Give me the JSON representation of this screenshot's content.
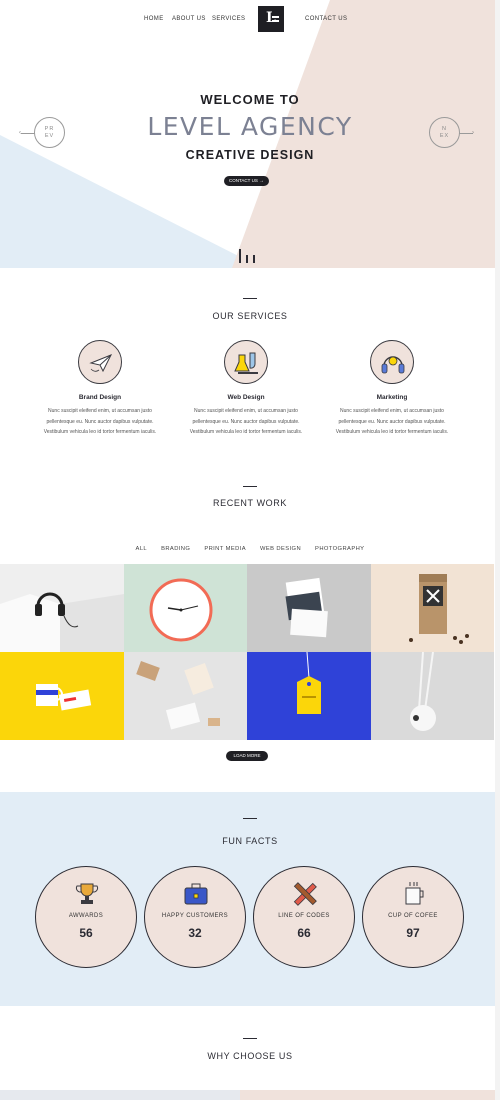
{
  "nav": {
    "items": [
      {
        "label": "HOME"
      },
      {
        "label": "ABOUT US"
      },
      {
        "label": "SERVICES"
      },
      {
        "label": "CONTACT US"
      }
    ],
    "logo_letter": "L"
  },
  "hero": {
    "welcome": "WELCOME TO",
    "title": "LEVEL AGENCY",
    "subtitle": "CREATIVE DESIGN",
    "cta": "CONTACT US",
    "prev": {
      "line1": "PR",
      "line2": "EV"
    },
    "next": {
      "line1": "N",
      "line2": "EX"
    }
  },
  "services": {
    "title": "OUR SERVICES",
    "items": [
      {
        "name": "Brand Design",
        "icon": "paper-plane-icon",
        "text": "Nunc suscipit eleifend enim, ut accumsan justo pellentesque eu. Nunc auctor dapibus vulputate. Vestibulum vehicula leo id tortor fermentum iaculis."
      },
      {
        "name": "Web Design",
        "icon": "flask-icon",
        "text": "Nunc suscipit eleifend enim, ut accumsan justo pellentesque eu. Nunc auctor dapibus vulputate. Vestibulum vehicula leo id tortor fermentum iaculis."
      },
      {
        "name": "Marketing",
        "icon": "headphones-icon",
        "text": "Nunc suscipit eleifend enim, ut accumsan justo pellentesque eu. Nunc auctor dapibus vulputate. Vestibulum vehicula leo id tortor fermentum iaculis."
      }
    ]
  },
  "work": {
    "title": "RECENT WORK",
    "filters": [
      "ALL",
      "BRADING",
      "PRINT MEDIA",
      "WEB DESIGN",
      "PHOTOGRAPHY"
    ],
    "tiles": [
      {
        "subject": "headphones",
        "bg": "#efefef"
      },
      {
        "subject": "wall-clock",
        "bg": "#cfe3d6"
      },
      {
        "subject": "business-cards",
        "bg": "#c9c9c9"
      },
      {
        "subject": "coffee-bag",
        "bg": "#f2e3d4"
      },
      {
        "subject": "mug-and-card",
        "bg": "#fbd60a"
      },
      {
        "subject": "stationery",
        "bg": "#e4e4e4"
      },
      {
        "subject": "hang-tag",
        "bg": "#2f42d8"
      },
      {
        "subject": "desk-lamp",
        "bg": "#dadada"
      }
    ],
    "load_more": "LOAD MORE"
  },
  "facts": {
    "title": "FUN FACTS",
    "items": [
      {
        "label": "AWWARDS",
        "value": "56",
        "icon": "trophy-icon"
      },
      {
        "label": "HAPPY CUSTOMERS",
        "value": "32",
        "icon": "briefcase-icon"
      },
      {
        "label": "LINE OF CODES",
        "value": "66",
        "icon": "pencil-ruler-icon"
      },
      {
        "label": "CUP OF COFEE",
        "value": "97",
        "icon": "coffee-cup-icon"
      }
    ]
  },
  "why": {
    "title": "WHY CHOOSE US"
  },
  "colors": {
    "dark": "#1f1f24",
    "blush": "#f0e2dc",
    "sky": "#e2edf6",
    "title_gray": "#7c8193"
  }
}
